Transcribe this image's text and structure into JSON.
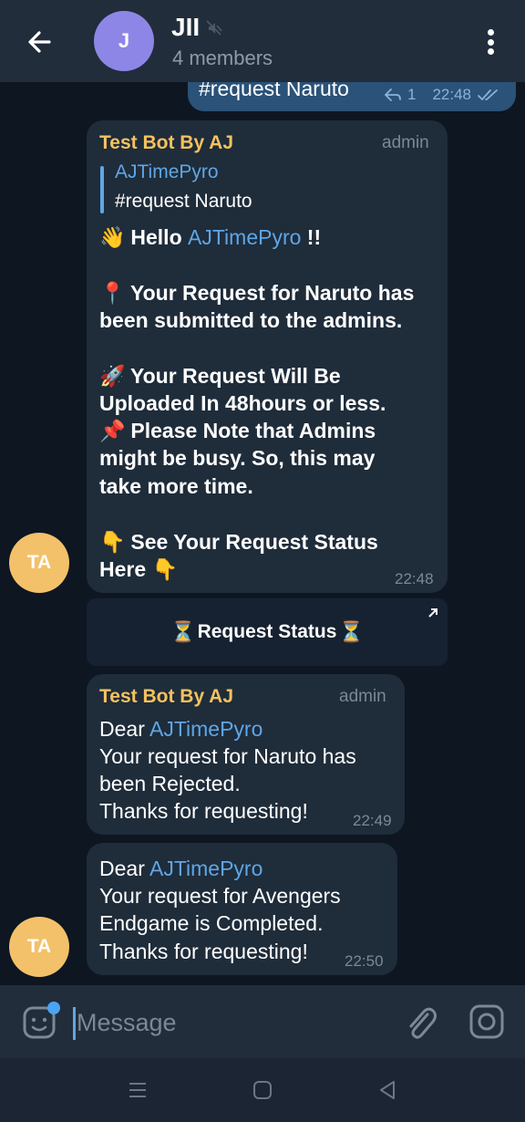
{
  "header": {
    "avatar_letter": "J",
    "title": "JII",
    "subtitle": "4 members",
    "back_icon": "arrow-left-icon",
    "mute_icon": "muted-icon",
    "menu_icon": "more-vert-icon"
  },
  "outgoing": {
    "text": "#request Naruto",
    "reply_count": "1",
    "time": "22:48",
    "status_icon": "double-check-icon"
  },
  "message1": {
    "sender": "Test Bot By AJ",
    "role": "admin",
    "reply_to_name": "AJTimePyro",
    "reply_to_text": "#request Naruto",
    "hello_prefix": "Hello",
    "hello_name": "AJTimePyro",
    "hello_suffix": "!!",
    "line_pin1": "Your Request for Naruto has",
    "line_pin2": "been submitted to the admins.",
    "line_rocket1": "Your Request Will Be",
    "line_rocket2": "Uploaded In 48hours or less.",
    "line_note1": "Please Note that Admins",
    "line_note2": "might be busy. So, this may",
    "line_note3": "take more time.",
    "line_see1": "See Your Request Status",
    "line_see2": "Here",
    "time": "22:48"
  },
  "inline_button": {
    "label": "Request Status"
  },
  "message2": {
    "sender": "Test Bot By AJ",
    "role": "admin",
    "dear": "Dear",
    "name": "AJTimePyro",
    "line1": "Your request for Naruto has",
    "line2": "been Rejected.",
    "line3": "Thanks for requesting!",
    "time": "22:49"
  },
  "message3": {
    "dear": "Dear",
    "name": "AJTimePyro",
    "line1": "Your request for Avengers",
    "line2": "Endgame is Completed.",
    "line3": "Thanks for requesting!",
    "time": "22:50"
  },
  "sender_avatar": {
    "initials": "TA",
    "color": "#f3c169"
  },
  "composer": {
    "placeholder": "Message"
  },
  "colors": {
    "background": "#0e1621",
    "header": "#212d3b",
    "bubble_in": "#1f2c3a",
    "bubble_out": "#2b5278",
    "sender_name": "#f5c25e",
    "link": "#5fa6e6"
  }
}
